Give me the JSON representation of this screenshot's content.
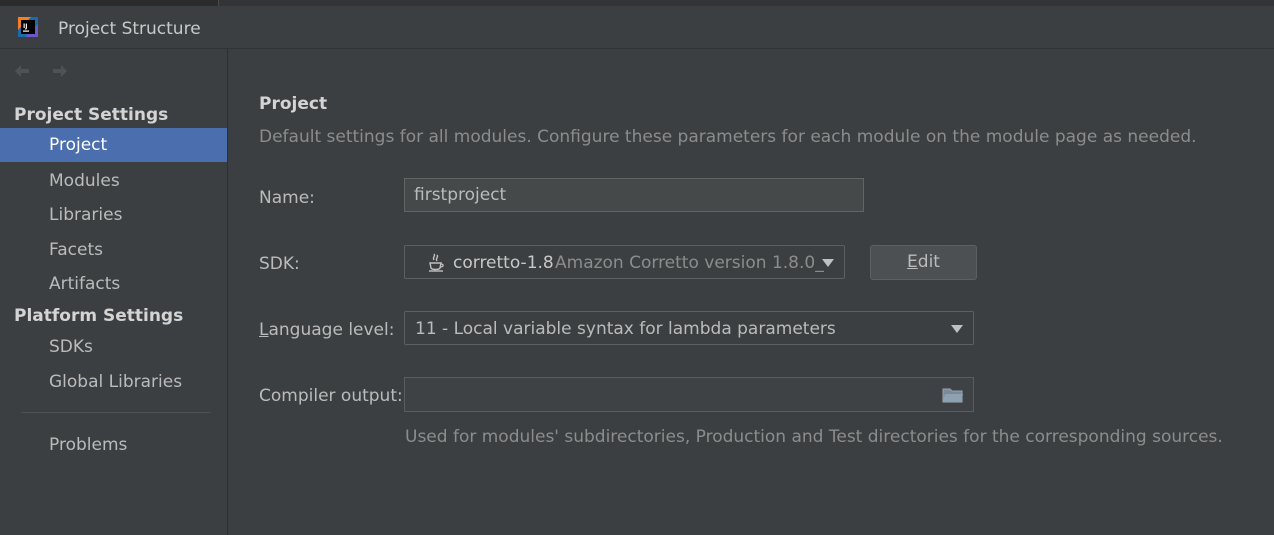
{
  "window": {
    "title": "Project Structure",
    "app_icon": "intellij-idea-icon"
  },
  "sidebar": {
    "nav": {
      "back_icon": "arrow-left-icon",
      "forward_icon": "arrow-right-icon"
    },
    "groups": [
      {
        "label": "Project Settings",
        "items": [
          "Project",
          "Modules",
          "Libraries",
          "Facets",
          "Artifacts"
        ]
      },
      {
        "label": "Platform Settings",
        "items": [
          "SDKs",
          "Global Libraries"
        ]
      }
    ],
    "problems_label": "Problems",
    "selected": "Project"
  },
  "main": {
    "title": "Project",
    "description": "Default settings for all modules. Configure these parameters for each module on the module page as needed.",
    "name": {
      "label": "Name:",
      "value": "firstproject"
    },
    "sdk": {
      "label": "SDK:",
      "icon": "java-icon",
      "name": "corretto-1.8",
      "description": "Amazon Corretto version 1.8.0_",
      "edit_button_mnemonic": "E",
      "edit_button_rest": "dit"
    },
    "language_level": {
      "label_mnemonic": "L",
      "label_rest": "anguage level:",
      "value": "11 - Local variable syntax for lambda parameters"
    },
    "compiler_output": {
      "label": "Compiler output:",
      "value": "",
      "icon": "folder-icon",
      "hint": "Used for modules' subdirectories, Production and Test directories for the corresponding sources."
    }
  },
  "colors": {
    "background": "#3c3f41",
    "selection": "#4b6eaf",
    "text": "#bbbbbb",
    "muted_text": "#8c8c8c"
  }
}
